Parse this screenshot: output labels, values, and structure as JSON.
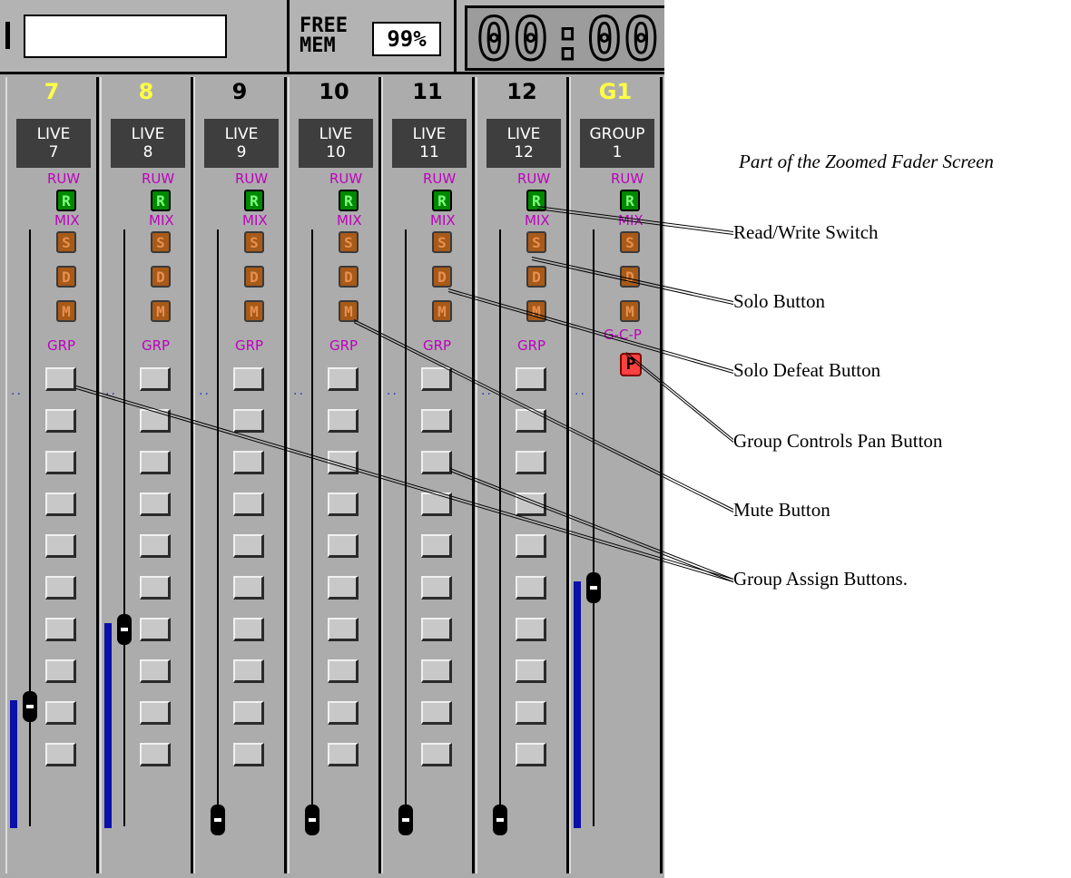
{
  "topbar": {
    "name_value": "",
    "free_mem_label": "FREE\nMEM",
    "free_mem_value": "99%",
    "timecode": "00:00:"
  },
  "channels": [
    {
      "number": "7",
      "number_color": "#ffff44",
      "name": "LIVE\n7",
      "rw_label": "RUW",
      "rw_button": "R",
      "mix_label": "MIX",
      "solo": "S",
      "defeat": "D",
      "mute": "M",
      "grp_label": "GRP",
      "fader_level": 0.22
    },
    {
      "number": "8",
      "number_color": "#ffff44",
      "name": "LIVE\n8",
      "rw_label": "RUW",
      "rw_button": "R",
      "mix_label": "MIX",
      "solo": "S",
      "defeat": "D",
      "mute": "M",
      "grp_label": "GRP",
      "fader_level": 0.37
    },
    {
      "number": "9",
      "number_color": "#000000",
      "name": "LIVE\n9",
      "rw_label": "RUW",
      "rw_button": "R",
      "mix_label": "MIX",
      "solo": "S",
      "defeat": "D",
      "mute": "M",
      "grp_label": "GRP",
      "fader_level": 0.0
    },
    {
      "number": "10",
      "number_color": "#000000",
      "name": "LIVE\n10",
      "rw_label": "RUW",
      "rw_button": "R",
      "mix_label": "MIX",
      "solo": "S",
      "defeat": "D",
      "mute": "M",
      "grp_label": "GRP",
      "fader_level": 0.0
    },
    {
      "number": "11",
      "number_color": "#000000",
      "name": "LIVE\n11",
      "rw_label": "RUW",
      "rw_button": "R",
      "mix_label": "MIX",
      "solo": "S",
      "defeat": "D",
      "mute": "M",
      "grp_label": "GRP",
      "fader_level": 0.0
    },
    {
      "number": "12",
      "number_color": "#000000",
      "name": "LIVE\n12",
      "rw_label": "RUW",
      "rw_button": "R",
      "mix_label": "MIX",
      "solo": "S",
      "defeat": "D",
      "mute": "M",
      "grp_label": "GRP",
      "fader_level": 0.0
    }
  ],
  "group": {
    "number": "G1",
    "number_color": "#ffff44",
    "name": "GROUP\n1",
    "rw_label": "RUW",
    "rw_button": "R",
    "mix_label": "MIX",
    "solo": "S",
    "defeat": "D",
    "mute": "M",
    "gcp_label": "G-C-P",
    "pan_button": "P",
    "fader_level": 0.45
  },
  "caption": "Part of the Zoomed Fader Screen",
  "callouts": {
    "rw": "Read/Write Switch",
    "solo": "Solo Button",
    "defeat": "Solo Defeat Button",
    "pan": "Group Controls Pan Button",
    "mute": "Mute Button",
    "group_assign": "Group Assign Buttons."
  },
  "colors": {
    "screen_bg": "#ababab",
    "label_purple": "#c000c0",
    "rw_green": "#008800",
    "button_orange": "#a85a18",
    "pan_red": "#ff4040",
    "level_blue": "#0a10a8"
  }
}
